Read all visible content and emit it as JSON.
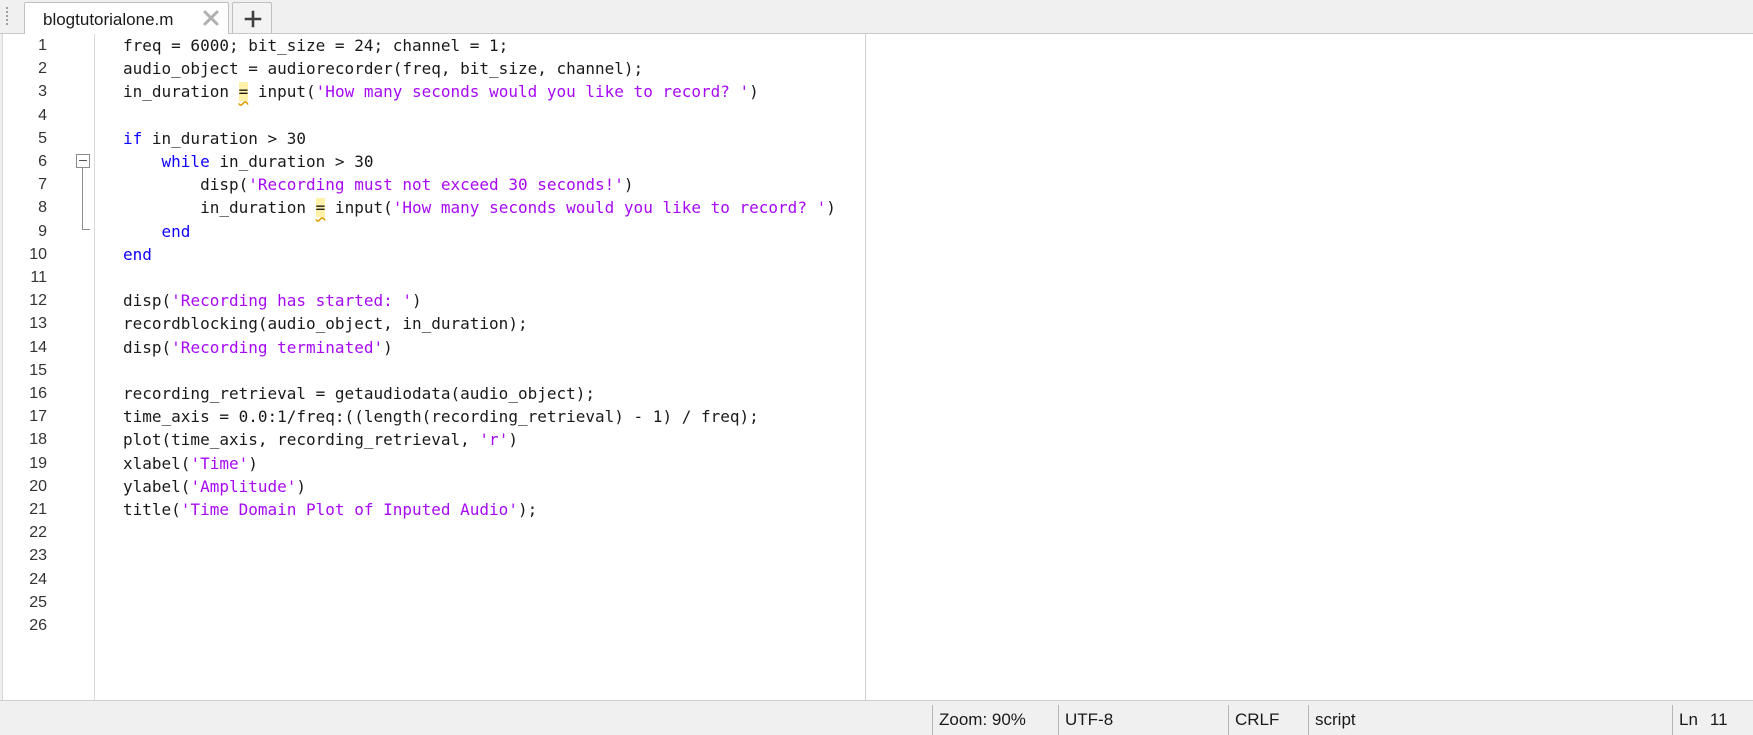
{
  "tab": {
    "filename": "blogtutorialone.m",
    "close_icon": "close-x-icon",
    "new_tab_icon": "plus-icon"
  },
  "editor": {
    "line_numbers": [
      "1",
      "2",
      "3",
      "4",
      "5",
      "6",
      "7",
      "8",
      "9",
      "10",
      "11",
      "12",
      "13",
      "14",
      "15",
      "16",
      "17",
      "18",
      "19",
      "20",
      "21",
      "22",
      "23",
      "24",
      "25",
      "26"
    ],
    "code_lines": [
      [
        {
          "t": "freq = 6000; bit_size = 24; channel = 1;",
          "c": ""
        }
      ],
      [
        {
          "t": "audio_object = audiorecorder(freq, bit_size, channel);",
          "c": ""
        }
      ],
      [
        {
          "t": "in_duration ",
          "c": ""
        },
        {
          "t": "=",
          "c": "warn"
        },
        {
          "t": " input(",
          "c": ""
        },
        {
          "t": "'How many seconds would you like to record? '",
          "c": "str"
        },
        {
          "t": ")",
          "c": ""
        }
      ],
      [],
      [
        {
          "t": "if",
          "c": "kw"
        },
        {
          "t": " in_duration > 30",
          "c": ""
        }
      ],
      [
        {
          "t": "    ",
          "c": ""
        },
        {
          "t": "while",
          "c": "kw"
        },
        {
          "t": " in_duration > 30",
          "c": ""
        }
      ],
      [
        {
          "t": "        disp(",
          "c": ""
        },
        {
          "t": "'Recording must not exceed 30 seconds!'",
          "c": "str"
        },
        {
          "t": ")",
          "c": ""
        }
      ],
      [
        {
          "t": "        in_duration ",
          "c": ""
        },
        {
          "t": "=",
          "c": "warn"
        },
        {
          "t": " input(",
          "c": ""
        },
        {
          "t": "'How many seconds would you like to record? '",
          "c": "str"
        },
        {
          "t": ")",
          "c": ""
        }
      ],
      [
        {
          "t": "    ",
          "c": ""
        },
        {
          "t": "end",
          "c": "kw"
        }
      ],
      [
        {
          "t": "end",
          "c": "kw"
        }
      ],
      [],
      [
        {
          "t": "disp(",
          "c": ""
        },
        {
          "t": "'Recording has started: '",
          "c": "str"
        },
        {
          "t": ")",
          "c": ""
        }
      ],
      [
        {
          "t": "recordblocking(audio_object, in_duration);",
          "c": ""
        }
      ],
      [
        {
          "t": "disp(",
          "c": ""
        },
        {
          "t": "'Recording terminated'",
          "c": "str"
        },
        {
          "t": ")",
          "c": ""
        }
      ],
      [],
      [
        {
          "t": "recording_retrieval = getaudiodata(audio_object);",
          "c": ""
        }
      ],
      [
        {
          "t": "time_axis = 0.0:1/freq:((length(recording_retrieval) - 1) / freq);",
          "c": ""
        }
      ],
      [
        {
          "t": "plot(time_axis, recording_retrieval, ",
          "c": ""
        },
        {
          "t": "'r'",
          "c": "str"
        },
        {
          "t": ")",
          "c": ""
        }
      ],
      [
        {
          "t": "xlabel(",
          "c": ""
        },
        {
          "t": "'Time'",
          "c": "str"
        },
        {
          "t": ")",
          "c": ""
        }
      ],
      [
        {
          "t": "ylabel(",
          "c": ""
        },
        {
          "t": "'Amplitude'",
          "c": "str"
        },
        {
          "t": ")",
          "c": ""
        }
      ],
      [
        {
          "t": "title(",
          "c": ""
        },
        {
          "t": "'Time Domain Plot of Inputed Audio'",
          "c": "str"
        },
        {
          "t": ");",
          "c": ""
        }
      ],
      [],
      [],
      [],
      [],
      []
    ],
    "colors": {
      "keyword": "#0e00ff",
      "string": "#a709f5",
      "warning_bg": "#fff1a8"
    }
  },
  "status_bar": {
    "zoom": "Zoom: 90%",
    "encoding": "UTF-8",
    "line_ending": "CRLF",
    "file_type": "script",
    "ln_label": "Ln",
    "ln_value": "11"
  }
}
